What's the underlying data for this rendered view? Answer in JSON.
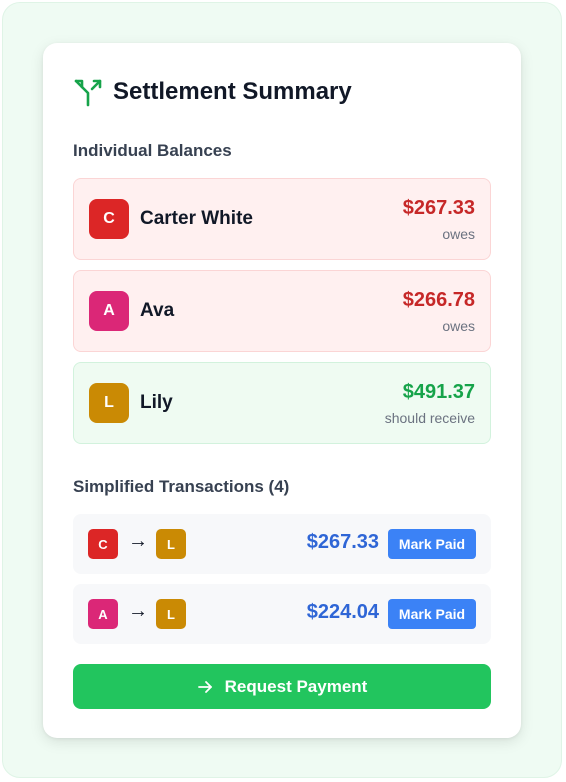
{
  "header": {
    "title": "Settlement Summary",
    "icon": "split-icon",
    "icon_color": "#16a34a"
  },
  "balances_section": {
    "label": "Individual Balances"
  },
  "balances": [
    {
      "initial": "C",
      "name": "Carter White",
      "amount": "$267.33",
      "status": "owes",
      "avatar_color": "#dc2626",
      "amount_color": "#c62828",
      "kind": "neg"
    },
    {
      "initial": "A",
      "name": "Ava",
      "amount": "$266.78",
      "status": "owes",
      "avatar_color": "#db2777",
      "amount_color": "#c62828",
      "kind": "neg"
    },
    {
      "initial": "L",
      "name": "Lily",
      "amount": "$491.37",
      "status": "should receive",
      "avatar_color": "#ca8a04",
      "amount_color": "#16a34a",
      "kind": "pos"
    }
  ],
  "transactions_section": {
    "label": "Simplified Transactions (4)"
  },
  "transactions": [
    {
      "from": "C",
      "to": "L",
      "amount": "$267.33",
      "button": "Mark Paid",
      "from_color": "#dc2626",
      "to_color": "#ca8a04"
    },
    {
      "from": "A",
      "to": "L",
      "amount": "$224.04",
      "button": "Mark Paid",
      "from_color": "#db2777",
      "to_color": "#ca8a04"
    }
  ],
  "arrow_glyph": "→",
  "request_button": {
    "label": "Request Payment",
    "icon": "arrow-right-icon"
  }
}
